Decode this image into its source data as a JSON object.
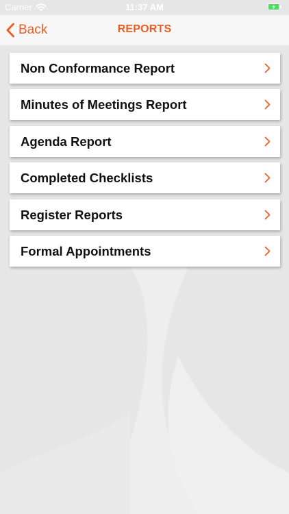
{
  "status_bar": {
    "carrier": "Carrier",
    "time": "11:37 AM",
    "wifi_icon": "wifi-icon",
    "battery_icon": "battery-charging-icon",
    "battery_color": "#4cd964"
  },
  "nav": {
    "back_label": "Back",
    "back_icon": "chevron-left-icon",
    "title": "REPORTS"
  },
  "theme": {
    "accent": "#ee5b23",
    "background": "#e6e6e6",
    "card": "#ffffff"
  },
  "reports": [
    {
      "label": "Non Conformance Report",
      "icon": "chevron-right-icon"
    },
    {
      "label": "Minutes of Meetings Report",
      "icon": "chevron-right-icon"
    },
    {
      "label": "Agenda Report",
      "icon": "chevron-right-icon"
    },
    {
      "label": "Completed Checklists",
      "icon": "chevron-right-icon"
    },
    {
      "label": "Register Reports",
      "icon": "chevron-right-icon"
    },
    {
      "label": "Formal Appointments",
      "icon": "chevron-right-icon"
    }
  ]
}
